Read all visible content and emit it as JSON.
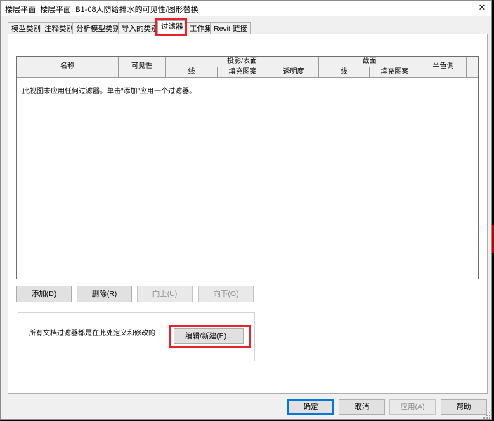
{
  "window": {
    "title": "楼层平面: 楼层平面: B1-08人防给排水的可见性/图形替换",
    "close": "✕"
  },
  "tabs": [
    {
      "label": "模型类别"
    },
    {
      "label": "注释类别"
    },
    {
      "label": "分析模型类别"
    },
    {
      "label": "导入的类别"
    },
    {
      "label": "过滤器"
    },
    {
      "label": "工作集"
    },
    {
      "label": "Revit 链接"
    }
  ],
  "active_tab": "过滤器",
  "table": {
    "headers": {
      "name": "名称",
      "visibility": "可见性",
      "projection_surface": "投影/表面",
      "proj_lines": "线",
      "proj_patterns": "填充图案",
      "proj_transparency": "透明度",
      "cut": "截面",
      "cut_lines": "线",
      "cut_patterns": "填充图案",
      "halftone": "半色调"
    },
    "empty_message": "此视图未应用任何过滤器。单击\"添加\"应用一个过滤器。"
  },
  "row_buttons": {
    "add": "添加(D)",
    "delete": "删除(R)",
    "up": "向上(U)",
    "down": "向下(O)"
  },
  "filter_group": {
    "info": "所有文档过滤器都是在此处定义和修改的",
    "edit_new": "编辑/新建(E)..."
  },
  "dialog_buttons": {
    "ok": "确定",
    "cancel": "取消",
    "apply": "应用(A)",
    "help": "帮助"
  },
  "colors": {
    "highlight": "#e8232b",
    "accent": "#0078d7"
  }
}
